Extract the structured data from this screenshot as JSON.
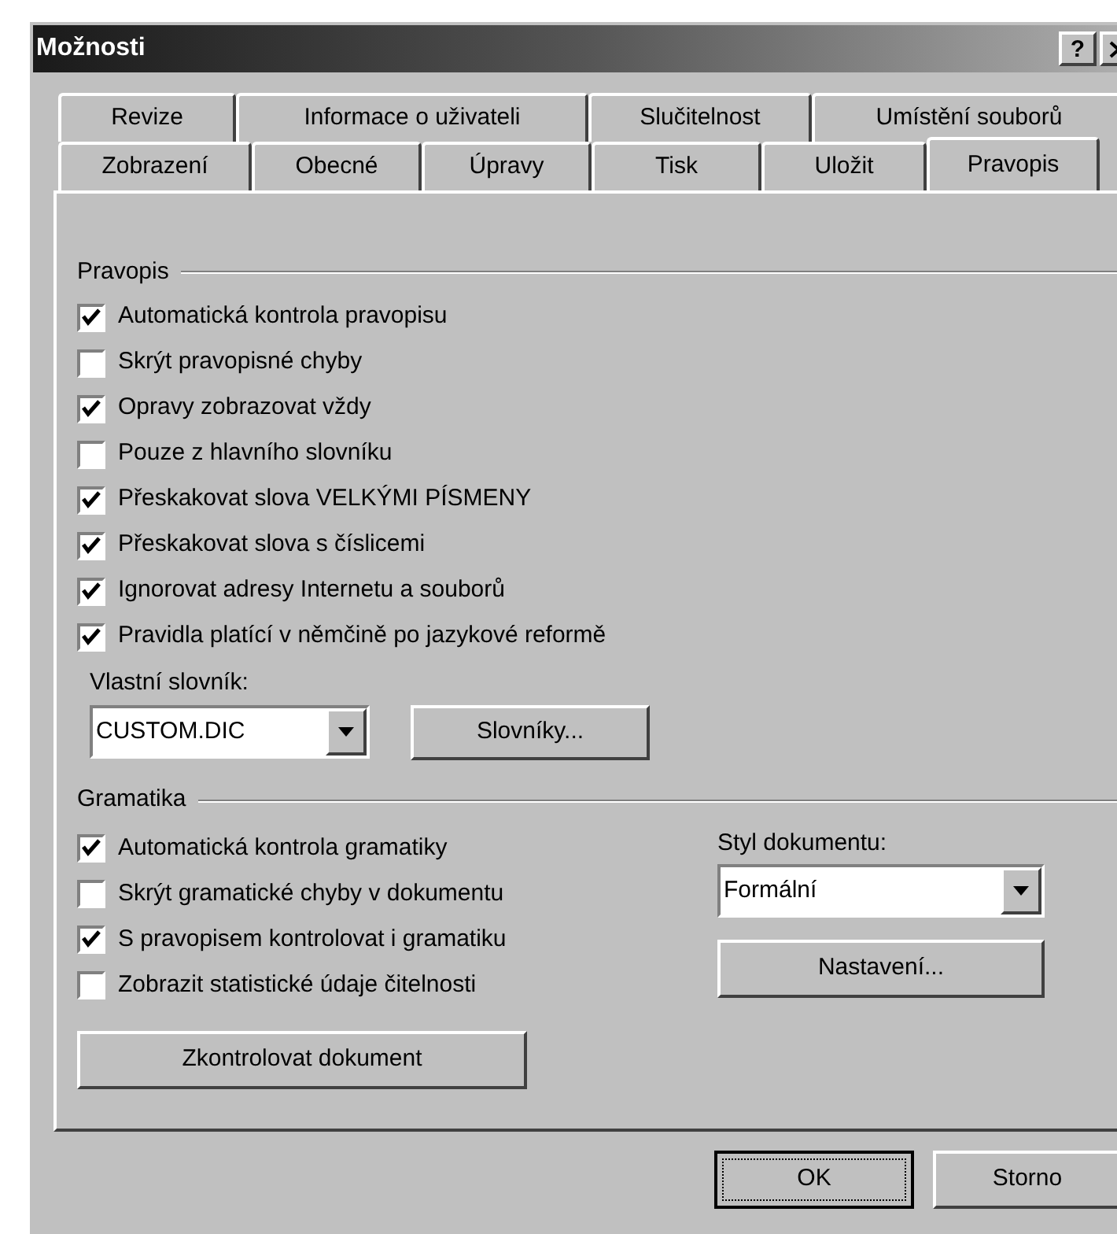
{
  "window": {
    "title": "Možnosti",
    "help_button": "?"
  },
  "tab_rows": [
    {
      "tabs": [
        {
          "label": "Revize",
          "selected": false
        },
        {
          "label": "Informace o uživateli",
          "selected": false
        },
        {
          "label": "Slučitelnost",
          "selected": false
        },
        {
          "label": "Umístění souborů",
          "selected": false
        }
      ]
    },
    {
      "tabs": [
        {
          "label": "Zobrazení",
          "selected": false
        },
        {
          "label": "Obecné",
          "selected": false
        },
        {
          "label": "Úpravy",
          "selected": false
        },
        {
          "label": "Tisk",
          "selected": false
        },
        {
          "label": "Uložit",
          "selected": false
        },
        {
          "label": "Pravopis",
          "selected": true
        }
      ]
    }
  ],
  "spelling": {
    "title": "Pravopis",
    "options": [
      {
        "label": "Automatická kontrola pravopisu",
        "checked": true
      },
      {
        "label": "Skrýt pravopisné chyby",
        "checked": false
      },
      {
        "label": "Opravy zobrazovat vždy",
        "checked": true
      },
      {
        "label": "Pouze z hlavního slovníku",
        "checked": false
      },
      {
        "label": "Přeskakovat slova VELKÝMI PÍSMENY",
        "checked": true
      },
      {
        "label": "Přeskakovat slova s číslicemi",
        "checked": true
      },
      {
        "label": "Ignorovat adresy Internetu a souborů",
        "checked": true
      },
      {
        "label": "Pravidla platící v němčině po jazykové reformě",
        "checked": true
      }
    ],
    "custom_dictionary": {
      "label": "Vlastní slovník:",
      "value": "CUSTOM.DIC"
    },
    "dictionaries_button": "Slovníky..."
  },
  "grammar": {
    "title": "Gramatika",
    "options": [
      {
        "label": "Automatická kontrola gramatiky",
        "checked": true
      },
      {
        "label": "Skrýt gramatické chyby v dokumentu",
        "checked": false
      },
      {
        "label": "S pravopisem kontrolovat i gramatiku",
        "checked": true
      },
      {
        "label": "Zobrazit statistické údaje čitelnosti",
        "checked": false
      }
    ],
    "document_style": {
      "label": "Styl dokumentu:",
      "value": "Formální"
    },
    "settings_button": "Nastavení...",
    "check_button": "Zkontrolovat dokument"
  },
  "buttons": [
    {
      "label": "OK",
      "default": true
    },
    {
      "label": "Storno",
      "default": false
    }
  ]
}
